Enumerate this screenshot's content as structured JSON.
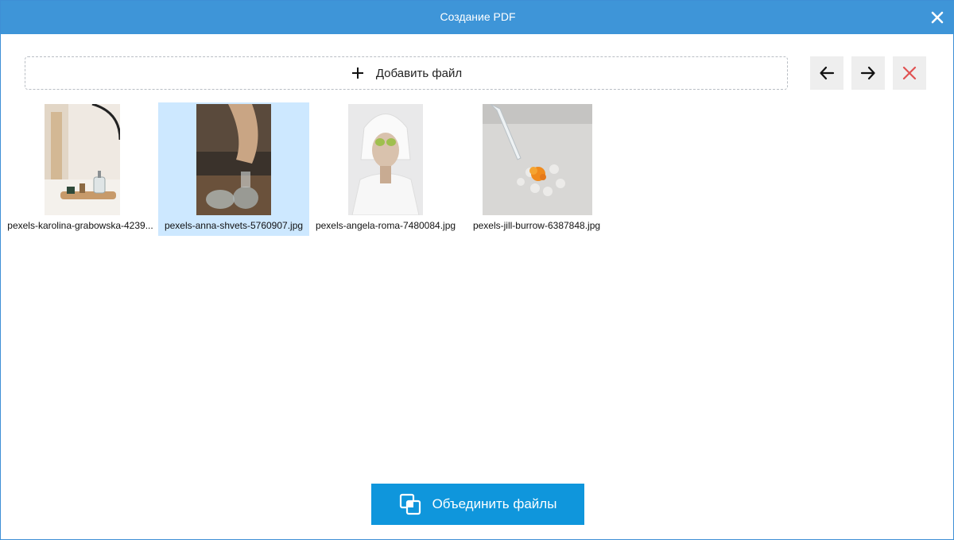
{
  "window": {
    "title": "Создание PDF",
    "close_icon": "close-icon"
  },
  "toolbar": {
    "add_file_label": "Добавить файл",
    "add_icon": "plus-icon",
    "move_left_icon": "arrow-left-icon",
    "move_right_icon": "arrow-right-icon",
    "delete_icon": "delete-x-icon",
    "delete_color": "#e05252"
  },
  "files": [
    {
      "name": "pexels-karolina-grabowska-4239...",
      "selected": false
    },
    {
      "name": "pexels-anna-shvets-5760907.jpg",
      "selected": true
    },
    {
      "name": "pexels-angela-roma-7480084.jpg",
      "selected": false
    },
    {
      "name": "pexels-jill-burrow-6387848.jpg",
      "selected": false
    }
  ],
  "footer": {
    "merge_label": "Объединить файлы",
    "merge_icon": "merge-files-icon"
  },
  "colors": {
    "titlebar": "#3e95d8",
    "selection": "#cde8ff",
    "primary_button": "#0f96dc"
  }
}
